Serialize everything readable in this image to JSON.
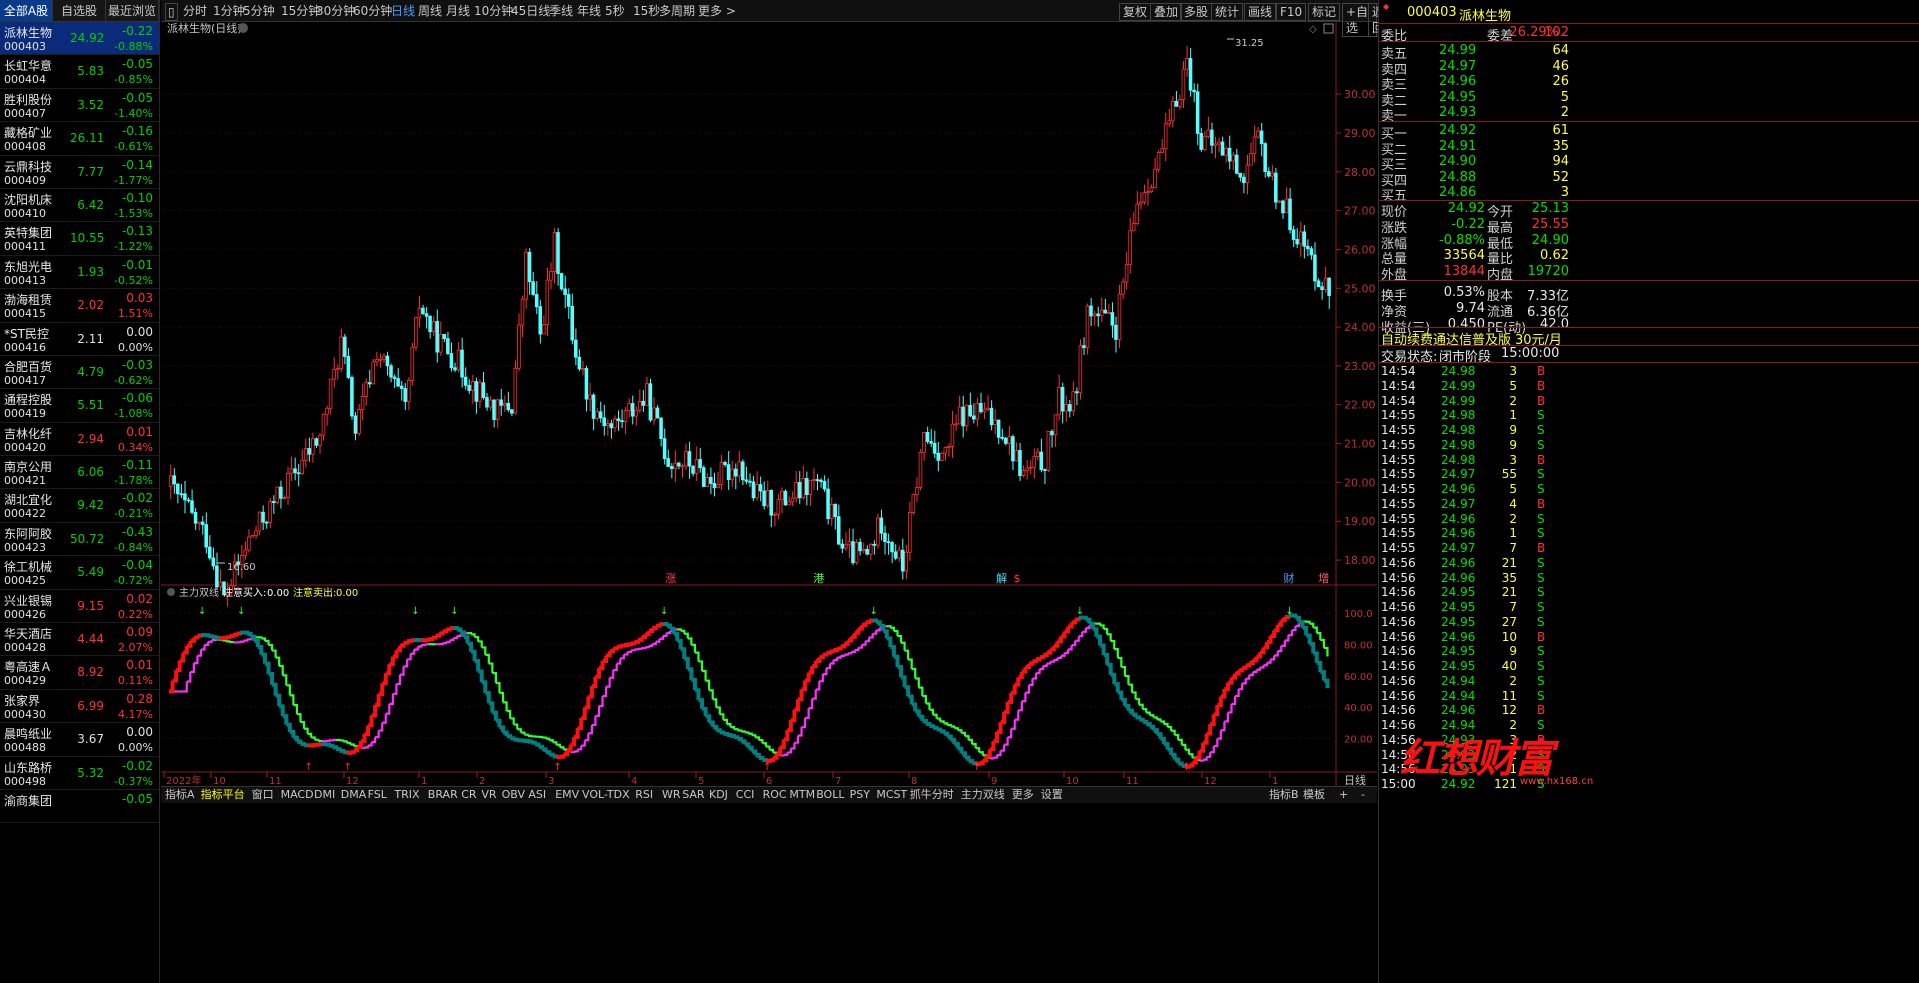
{
  "left_tabs": [
    "全部A股",
    "自选股",
    "最近浏览"
  ],
  "stocks": [
    {
      "name": "派林生物",
      "code": "000403",
      "price": "24.92",
      "change": "-0.22",
      "pct": "-0.88%",
      "dir": "dn"
    },
    {
      "name": "长虹华意",
      "code": "000404",
      "price": "5.83",
      "change": "-0.05",
      "pct": "-0.85%",
      "dir": "dn"
    },
    {
      "name": "胜利股份",
      "code": "000407",
      "price": "3.52",
      "change": "-0.05",
      "pct": "-1.40%",
      "dir": "dn"
    },
    {
      "name": "藏格矿业",
      "code": "000408",
      "price": "26.11",
      "change": "-0.16",
      "pct": "-0.61%",
      "dir": "dn"
    },
    {
      "name": "云鼎科技",
      "code": "000409",
      "price": "7.77",
      "change": "-0.14",
      "pct": "-1.77%",
      "dir": "dn"
    },
    {
      "name": "沈阳机床",
      "code": "000410",
      "price": "6.42",
      "change": "-0.10",
      "pct": "-1.53%",
      "dir": "dn"
    },
    {
      "name": "英特集团",
      "code": "000411",
      "price": "10.55",
      "change": "-0.13",
      "pct": "-1.22%",
      "dir": "dn"
    },
    {
      "name": "东旭光电",
      "code": "000413",
      "price": "1.93",
      "change": "-0.01",
      "pct": "-0.52%",
      "dir": "dn"
    },
    {
      "name": "渤海租赁",
      "code": "000415",
      "price": "2.02",
      "change": "0.03",
      "pct": "1.51%",
      "dir": "up"
    },
    {
      "name": "*ST民控",
      "code": "000416",
      "price": "2.11",
      "change": "0.00",
      "pct": "0.00%",
      "dir": "eq"
    },
    {
      "name": "合肥百货",
      "code": "000417",
      "price": "4.79",
      "change": "-0.03",
      "pct": "-0.62%",
      "dir": "dn"
    },
    {
      "name": "通程控股",
      "code": "000419",
      "price": "5.51",
      "change": "-0.06",
      "pct": "-1.08%",
      "dir": "dn"
    },
    {
      "name": "吉林化纤",
      "code": "000420",
      "price": "2.94",
      "change": "0.01",
      "pct": "0.34%",
      "dir": "up"
    },
    {
      "name": "南京公用",
      "code": "000421",
      "price": "6.06",
      "change": "-0.11",
      "pct": "-1.78%",
      "dir": "dn"
    },
    {
      "name": "湖北宜化",
      "code": "000422",
      "price": "9.42",
      "change": "-0.02",
      "pct": "-0.21%",
      "dir": "dn"
    },
    {
      "name": "东阿阿胶",
      "code": "000423",
      "price": "50.72",
      "change": "-0.43",
      "pct": "-0.84%",
      "dir": "dn"
    },
    {
      "name": "徐工机械",
      "code": "000425",
      "price": "5.49",
      "change": "-0.04",
      "pct": "-0.72%",
      "dir": "dn"
    },
    {
      "name": "兴业银锡",
      "code": "000426",
      "price": "9.15",
      "change": "0.02",
      "pct": "0.22%",
      "dir": "up"
    },
    {
      "name": "华天酒店",
      "code": "000428",
      "price": "4.44",
      "change": "0.09",
      "pct": "2.07%",
      "dir": "up"
    },
    {
      "name": "粤高速Ａ",
      "code": "000429",
      "price": "8.92",
      "change": "0.01",
      "pct": "0.11%",
      "dir": "up"
    },
    {
      "name": "张家界",
      "code": "000430",
      "price": "6.99",
      "change": "0.28",
      "pct": "4.17%",
      "dir": "up"
    },
    {
      "name": "晨鸣纸业",
      "code": "000488",
      "price": "3.67",
      "change": "0.00",
      "pct": "0.00%",
      "dir": "eq"
    },
    {
      "name": "山东路桥",
      "code": "000498",
      "price": "5.32",
      "change": "-0.02",
      "pct": "-0.37%",
      "dir": "dn"
    },
    {
      "name": "渝商集团",
      "code": "",
      "price": "",
      "change": "-0.05",
      "pct": "",
      "dir": "dn"
    }
  ],
  "toolbar": {
    "periods": [
      "分时",
      "1分钟",
      "5分钟",
      "15分钟",
      "30分钟",
      "60分钟",
      "日线",
      "周线",
      "月线",
      "10分钟",
      "45日线",
      "季线",
      "年线",
      "5秒",
      "15秒",
      "多周期",
      "更多 >"
    ],
    "active_period": "日线",
    "right_buttons": [
      "复权",
      "叠加",
      "多股",
      "统计",
      "画线",
      "F10",
      "标记",
      "+自选",
      "返回"
    ]
  },
  "chart": {
    "title": "派林生物(日线)",
    "high_label": "31.25",
    "low_label": "16.60",
    "price_axis": [
      "30.00",
      "29.00",
      "28.00",
      "27.00",
      "26.00",
      "25.00",
      "24.00",
      "23.00",
      "22.00",
      "21.00",
      "20.00",
      "19.00",
      "18.00"
    ],
    "price_range": [
      17.1,
      31.6
    ],
    "markers": [
      {
        "text": "涨",
        "color": "#ff4040",
        "bar": 57
      },
      {
        "text": "港",
        "color": "#40ff40",
        "bar": 74
      },
      {
        "text": "解",
        "color": "#40e0ff",
        "bar": 95
      },
      {
        "text": "$",
        "color": "#ff4040",
        "bar": 97
      },
      {
        "text": "财",
        "color": "#40a0ff",
        "bar": 128
      },
      {
        "text": "增",
        "color": "#ff6060",
        "bar": 132
      }
    ],
    "indicator_name": "主力双线",
    "indicator_buy_label": "注意买入:",
    "indicator_buy_value": "0.00",
    "indicator_sell_label": "注意卖出:",
    "indicator_sell_value": "0.00",
    "indicator_axis": [
      "100.0",
      "80.00",
      "60.00",
      "40.00",
      "20.00"
    ],
    "month_labels": [
      "2022年",
      "10",
      "11",
      "12",
      "1",
      "2",
      "3",
      "4",
      "5",
      "6",
      "7",
      "8",
      "9",
      "10",
      "11",
      "12",
      "1"
    ],
    "right_label": "日线"
  },
  "bottom_tabs": [
    "指标A",
    "指标平台",
    "窗口",
    "MACD",
    "DMI",
    "DMA",
    "FSL",
    "TRIX",
    "BRAR",
    "CR",
    "VR",
    "OBV",
    "ASI",
    "EMV",
    "VOL-TDX",
    "RSI",
    "WR",
    "SAR",
    "KDJ",
    "CCI",
    "ROC",
    "MTM",
    "BOLL",
    "PSY",
    "MCST",
    "抓牛分时",
    "主力双线",
    "更多",
    "设置"
  ],
  "bottom_right": [
    "指标B",
    "模板",
    "+",
    "-"
  ],
  "quote": {
    "code": "000403",
    "name": "派林生物",
    "ratio_label": "委比",
    "ratio": "26.29%",
    "diff_label": "委差",
    "diff": "102",
    "asks": [
      {
        "label": "卖五",
        "price": "24.99",
        "vol": "64"
      },
      {
        "label": "卖四",
        "price": "24.97",
        "vol": "46"
      },
      {
        "label": "卖三",
        "price": "24.96",
        "vol": "26"
      },
      {
        "label": "卖二",
        "price": "24.95",
        "vol": "5"
      },
      {
        "label": "卖一",
        "price": "24.93",
        "vol": "2"
      }
    ],
    "bids": [
      {
        "label": "买一",
        "price": "24.92",
        "vol": "61"
      },
      {
        "label": "买二",
        "price": "24.91",
        "vol": "35"
      },
      {
        "label": "买三",
        "price": "24.90",
        "vol": "94"
      },
      {
        "label": "买四",
        "price": "24.88",
        "vol": "52"
      },
      {
        "label": "买五",
        "price": "24.86",
        "vol": "3"
      }
    ],
    "stats": [
      {
        "l1": "现价",
        "v1": "24.92",
        "c1": "grn",
        "l2": "今开",
        "v2": "25.13",
        "c2": "grn"
      },
      {
        "l1": "涨跌",
        "v1": "-0.22",
        "c1": "grn",
        "l2": "最高",
        "v2": "25.55",
        "c2": "red"
      },
      {
        "l1": "涨幅",
        "v1": "-0.88%",
        "c1": "grn",
        "l2": "最低",
        "v2": "24.90",
        "c2": "grn"
      },
      {
        "l1": "总量",
        "v1": "33564",
        "c1": "yel",
        "l2": "量比",
        "v2": "0.62",
        "c2": "yel"
      },
      {
        "l1": "外盘",
        "v1": "13844",
        "c1": "red",
        "l2": "内盘",
        "v2": "19720",
        "c2": "grn"
      },
      {
        "l1": "换手",
        "v1": "0.53%",
        "c1": "wht",
        "l2": "股本",
        "v2": "7.33亿",
        "c2": "wht"
      },
      {
        "l1": "净资",
        "v1": "9.74",
        "c1": "wht",
        "l2": "流通",
        "v2": "6.36亿",
        "c2": "wht"
      },
      {
        "l1": "收益(三)",
        "v1": "0.450",
        "c1": "wht",
        "l2": "PE(动)",
        "v2": "42.0",
        "c2": "wht"
      }
    ],
    "promo": "自动续费通达信普及版",
    "promo_price": "30元/月",
    "status_label": "交易状态:",
    "status": "闭市阶段",
    "status_time": "15:00:00",
    "trades": [
      {
        "t": "14:54",
        "p": "24.98",
        "v": "3",
        "s": "B"
      },
      {
        "t": "14:54",
        "p": "24.99",
        "v": "5",
        "s": "B"
      },
      {
        "t": "14:54",
        "p": "24.99",
        "v": "2",
        "s": "B"
      },
      {
        "t": "14:55",
        "p": "24.98",
        "v": "1",
        "s": "S"
      },
      {
        "t": "14:55",
        "p": "24.98",
        "v": "9",
        "s": "S"
      },
      {
        "t": "14:55",
        "p": "24.98",
        "v": "9",
        "s": "S"
      },
      {
        "t": "14:55",
        "p": "24.98",
        "v": "3",
        "s": "B"
      },
      {
        "t": "14:55",
        "p": "24.97",
        "v": "55",
        "s": "S"
      },
      {
        "t": "14:55",
        "p": "24.96",
        "v": "5",
        "s": "S"
      },
      {
        "t": "14:55",
        "p": "24.97",
        "v": "4",
        "s": "B"
      },
      {
        "t": "14:55",
        "p": "24.96",
        "v": "2",
        "s": "S"
      },
      {
        "t": "14:55",
        "p": "24.96",
        "v": "1",
        "s": "S"
      },
      {
        "t": "14:55",
        "p": "24.97",
        "v": "7",
        "s": "B"
      },
      {
        "t": "14:56",
        "p": "24.96",
        "v": "21",
        "s": "S"
      },
      {
        "t": "14:56",
        "p": "24.96",
        "v": "35",
        "s": "S"
      },
      {
        "t": "14:56",
        "p": "24.95",
        "v": "21",
        "s": "S"
      },
      {
        "t": "14:56",
        "p": "24.95",
        "v": "7",
        "s": "S"
      },
      {
        "t": "14:56",
        "p": "24.95",
        "v": "27",
        "s": "S"
      },
      {
        "t": "14:56",
        "p": "24.96",
        "v": "10",
        "s": "B"
      },
      {
        "t": "14:56",
        "p": "24.95",
        "v": "9",
        "s": "S"
      },
      {
        "t": "14:56",
        "p": "24.95",
        "v": "40",
        "s": "S"
      },
      {
        "t": "14:56",
        "p": "24.94",
        "v": "2",
        "s": "S"
      },
      {
        "t": "14:56",
        "p": "24.94",
        "v": "11",
        "s": "S"
      },
      {
        "t": "14:56",
        "p": "24.96",
        "v": "12",
        "s": "B"
      },
      {
        "t": "14:56",
        "p": "24.94",
        "v": "2",
        "s": "S"
      },
      {
        "t": "14:56",
        "p": "24.93",
        "v": "3",
        "s": "B"
      },
      {
        "t": "14:56",
        "p": "24.93",
        "v": "2",
        "s": "S"
      },
      {
        "t": "14:56",
        "p": "24.93",
        "v": "1",
        "s": "S"
      }
    ],
    "close_trade": {
      "t": "15:00",
      "p": "24.92",
      "v": "121",
      "s": "S"
    }
  },
  "watermark": "红想财富",
  "watermark_site": "www.hx168.cn"
}
